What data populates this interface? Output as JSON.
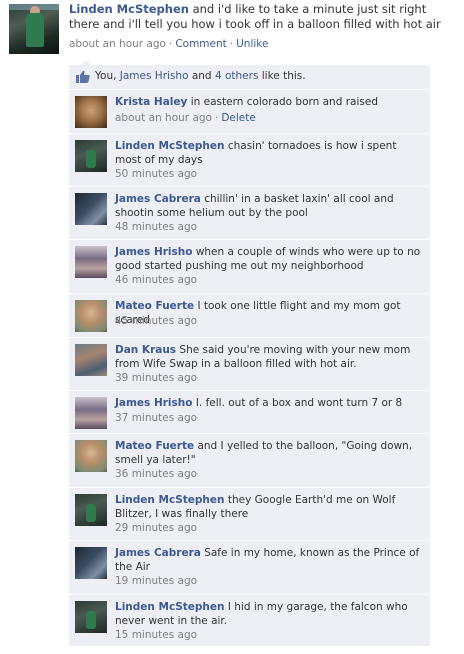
{
  "post": {
    "author": "Linden McStephen",
    "text": "and i'd like to take a minute just sit right there and i'll tell you how i took off in a balloon filled with hot air",
    "time": "about an hour ago",
    "separator": "·",
    "comment_link": "Comment",
    "unlike_link": "Unlike"
  },
  "likes": {
    "prefix": "You,",
    "person": "James Hrisho",
    "middle": "and",
    "others_link": "4 others",
    "suffix": "like this."
  },
  "comments": [
    {
      "author": "Krista Haley",
      "text": "in eastern colorado born and raised",
      "time": "about an hour ago",
      "delete": "Delete",
      "avatar": "krista"
    },
    {
      "author": "Linden McStephen",
      "text": "chasin' tornadoes is how i spent most of my days",
      "time": "50 minutes ago",
      "avatar": "linden"
    },
    {
      "author": "James Cabrera",
      "text": "chillin' in a basket laxin' all cool and shootin some helium out by the pool",
      "time": "48 minutes ago",
      "avatar": "cabrera"
    },
    {
      "author": "James Hrisho",
      "text": "when a couple of winds who were up to no good started pushing me out my neighborhood",
      "time": "46 minutes ago",
      "avatar": "hrisho"
    },
    {
      "author": "Mateo Fuerte",
      "text": "I took one little flight and my mom got scared",
      "time": "45 minutes ago",
      "avatar": "mateo"
    },
    {
      "author": "Dan Kraus",
      "text": "She said you're moving with your new mom from Wife Swap in a balloon filled with hot air.",
      "time": "39 minutes ago",
      "avatar": "dan"
    },
    {
      "author": "James Hrisho",
      "text": "I. fell. out of a box and wont turn 7 or 8",
      "time": "37 minutes ago",
      "avatar": "hrisho"
    },
    {
      "author": "Mateo Fuerte",
      "text": "and I yelled to the balloon, \"Going down, smell ya later!\"",
      "time": "36 minutes ago",
      "avatar": "mateo"
    },
    {
      "author": "Linden McStephen",
      "text": "they Google Earth'd me on Wolf Blitzer, I was finally there",
      "time": "29 minutes ago",
      "avatar": "linden"
    },
    {
      "author": "James Cabrera",
      "text": "Safe in my home, known as the Prince of the Air",
      "time": "19 minutes ago",
      "avatar": "cabrera"
    },
    {
      "author": "Linden McStephen",
      "text": "I hid in my garage, the falcon who never went in the air.",
      "time": "15 minutes ago",
      "avatar": "linden"
    }
  ],
  "colors": {
    "link": "#3b5998",
    "comment_bg": "#edeff4",
    "meta_text": "#808080"
  }
}
